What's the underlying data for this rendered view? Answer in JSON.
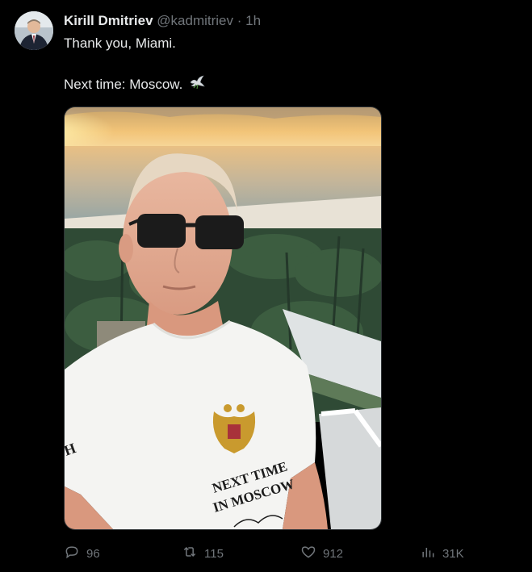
{
  "tweet": {
    "author_name": "Kirill Dmitriev",
    "handle": "@kadmitriev",
    "separator": "·",
    "time": "1h",
    "text_line1": "Thank you, Miami.",
    "text_line2": "Next time: Moscow.",
    "emoji_icon": "dove-icon"
  },
  "photo": {
    "shirt_text_line1": "NEXT TIME",
    "shirt_text_line2": "IN MOSCOW",
    "sleeve_text": "H"
  },
  "actions": {
    "replies": "96",
    "reposts": "115",
    "likes": "912",
    "views": "31K"
  },
  "colors": {
    "background": "#000000",
    "text_primary": "#e7e9ea",
    "text_secondary": "#71767b"
  }
}
